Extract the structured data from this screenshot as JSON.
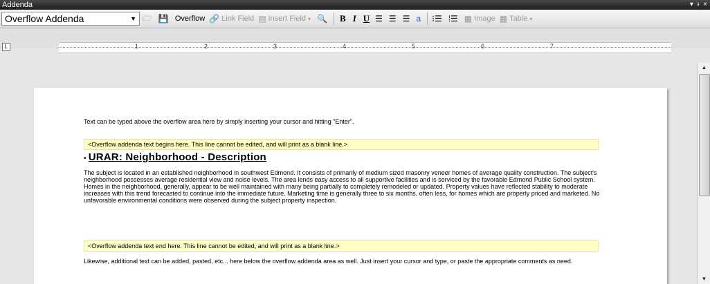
{
  "window": {
    "title": "Addenda",
    "controls": [
      "▾",
      "ᵼ",
      "×"
    ]
  },
  "toolbar": {
    "dropdown_value": "Overflow Addenda",
    "overflow_label": "Overflow",
    "link_field_label": "Link Field",
    "insert_field_label": "Insert Field",
    "bold": "B",
    "italic": "I",
    "underline": "U",
    "image_label": "Image",
    "table_label": "Table"
  },
  "ruler": {
    "numbers": [
      "1",
      "2",
      "3",
      "4",
      "5",
      "6",
      "7"
    ]
  },
  "document": {
    "intro_text": "Text can be typed above the overflow area here by simply inserting your cursor and hitting \"Enter\".",
    "overflow_begin": "<Overflow addenda text begins here.  This line cannot be edited, and will print as a blank line.>",
    "heading": "URAR: Neighborhood - Description",
    "body": "The subject is located in an established neighborhood in southwest Edmond. It consists of primarily of medium sized masonry veneer homes of average quality construction. The subject's neighborhood possesses average residential view and noise levels. The area lends easy access to all supportive facilities and is serviced by the favorable Edmond Public School system. Homes in the neighborhood, generally, appear to be well maintained with many being partially to completely remodeled or updated. Property values have reflected stability to moderate increases with this trend forecasted to continue into the immediate future. Marketing time is generally three to six months, often less, for homes which are properly priced and marketed. No unfavorable environmental conditions were observed during the subject property inspection.",
    "overflow_end": "<Overflow addenda text end here.  This line cannot be edited, and will print as a blank line.>",
    "outro_text": "Likewise, additional text can be added, pasted, etc...  here below the overflow addenda area as well.  Just insert your cursor and type, or paste the appropriate comments as need."
  }
}
